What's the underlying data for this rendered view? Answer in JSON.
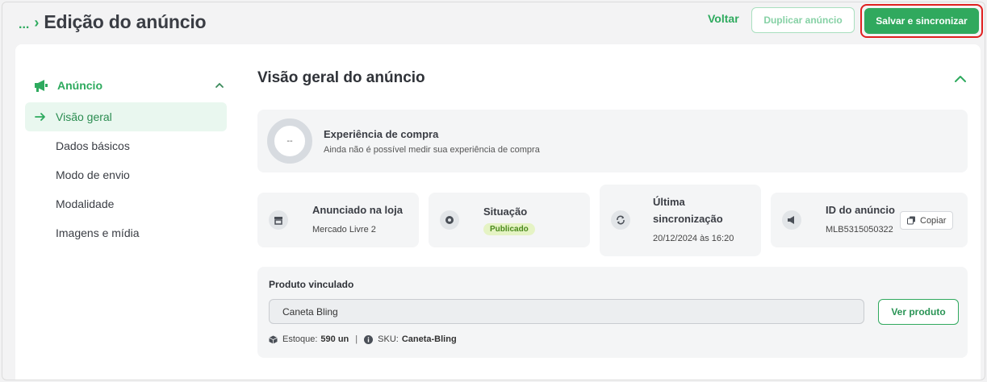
{
  "header": {
    "breadcrumb_dots": "...",
    "title": "Edição do anúncio",
    "voltar_label": "Voltar",
    "duplicate_label": "Duplicar anúncio",
    "save_label": "Salvar e sincronizar"
  },
  "sidebar": {
    "section_label": "Anúncio",
    "section_icon": "megaphone-icon",
    "items": [
      {
        "label": "Visão geral",
        "active": true
      },
      {
        "label": "Dados básicos"
      },
      {
        "label": "Modo de envio"
      },
      {
        "label": "Modalidade"
      },
      {
        "label": "Imagens e mídia"
      }
    ]
  },
  "main": {
    "title": "Visão geral do anúncio",
    "experience": {
      "ring_value": "--",
      "title": "Experiência de compra",
      "subtitle": "Ainda não é possível medir sua experiência de compra"
    },
    "stats": {
      "store": {
        "title": "Anunciado na loja",
        "value": "Mercado Livre 2",
        "icon": "store-icon"
      },
      "status": {
        "title": "Situação",
        "value": "Publicado",
        "icon": "status-icon"
      },
      "sync": {
        "title_line1": "Última",
        "title_line2": "sincronização",
        "value": "20/12/2024 às 16:20",
        "icon": "sync-icon"
      },
      "id": {
        "title": "ID do anúncio",
        "value": "MLB5315050322",
        "copy_label": "Copiar",
        "icon": "megaphone-icon"
      }
    },
    "product": {
      "title": "Produto vinculado",
      "input_value": "Caneta Bling",
      "view_label": "Ver produto",
      "stock_label": "Estoque:",
      "stock_value": "590 un",
      "sep": "|",
      "sku_label": "SKU:",
      "sku_value": "Caneta-Bling"
    }
  },
  "colors": {
    "brand_green": "#30a95e",
    "highlight_red": "#e02020",
    "published_badge": "#e5f3c4"
  }
}
